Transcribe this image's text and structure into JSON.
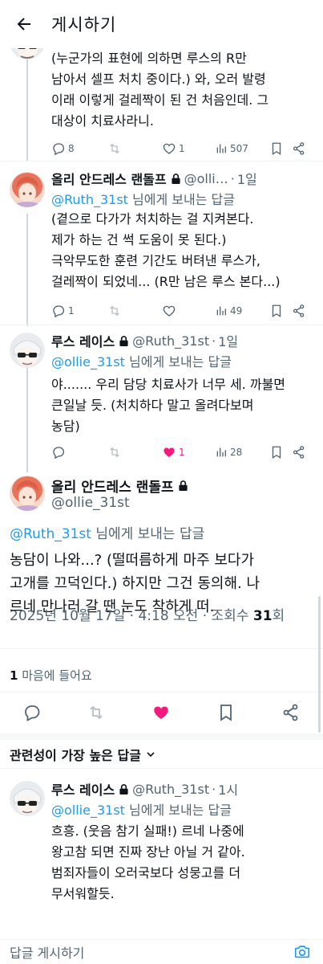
{
  "header": {
    "title": "게시하기"
  },
  "replies": [
    {
      "text": "(누군가의 표현에 의하면 루스의 R만\n남아서 셀프 처치 중이다.) 와, 오러 발령\n이래 이렇게 걸레짝이 된 건 처음인데. 그\n대상이 치료사라니.",
      "stats": {
        "replies": "8",
        "reposts": "",
        "likes": "1",
        "views": "507"
      }
    },
    {
      "name": "올리 안드레스 랜돌프",
      "handle": "@olli…",
      "time": "1일",
      "replying_mention": "@Ruth_31st",
      "replying_suffix": " 님에게 보내는 답글",
      "text": "(곁으로 다가가 처치하는 걸 지켜본다.\n제가 하는 건 썩 도움이 못 된다.)\n극악무도한 훈련 기간도 버텨낸 루스가,\n걸레짝이 되었네... (R만 남은 루스 본다...)",
      "stats": {
        "replies": "1",
        "reposts": "",
        "likes": "",
        "views": "49"
      }
    },
    {
      "name": "루스 레이스",
      "handle": "@Ruth_31st",
      "time": "1일",
      "replying_mention": "@ollie_31st",
      "replying_suffix": " 님에게 보내는 답글",
      "text": "야....... 우리 담당 치료사가 너무 세. 까불면\n큰일날 듯. (처치하다 말고 올려다보며\n농담)",
      "stats": {
        "replies": "",
        "reposts": "",
        "likes": "1",
        "views": "28"
      }
    }
  ],
  "main_post": {
    "name": "올리 안드레스 랜돌프",
    "handle": "@ollie_31st",
    "replying_mention": "@Ruth_31st",
    "replying_suffix": " 님에게 보내는 답글",
    "text": "농담이 나와...? (떨떠름하게 마주 보다가\n고개를 끄덕인다.) 하지만 그건 동의해. 나\n르네 만나러 갈 땐 눈도 착하게 떠.",
    "date": "2025년 10월 17일 · 4:18 오전 · 조회수 ",
    "views": "31",
    "views_unit": "회",
    "like_count": "1",
    "like_label": " 마음에 들어요"
  },
  "relevance": {
    "label": "관련성이 가장 높은 답글"
  },
  "bottom_reply": {
    "name": "루스 레이스",
    "handle": "@Ruth_31st",
    "time": "1시",
    "replying_mention": "@ollie_31st",
    "replying_suffix": " 님에게 보내는 답글",
    "text": "흐흥. (웃음 참기 실패!) 르네 나중에\n왕고참 되면 진짜 장난 아닐 거 같아.\n범죄자들이 오러국보다 성뭉고를 더\n무서워할듯."
  },
  "compose": {
    "placeholder": "답글 게시하기"
  },
  "colors": {
    "text": "#0f1419",
    "secondary": "#536471",
    "link": "#1d9bf0",
    "like": "#f91880",
    "divider": "#eff3f4",
    "thread_line": "#cfd9de"
  },
  "icons": {
    "back": "arrow-left-icon",
    "lock": "lock-icon",
    "reply": "reply-icon",
    "repost": "repost-icon",
    "like": "heart-icon",
    "views": "bar-chart-icon",
    "bookmark": "bookmark-icon",
    "share": "share-icon",
    "chevron": "chevron-down-icon",
    "camera": "camera-icon"
  }
}
